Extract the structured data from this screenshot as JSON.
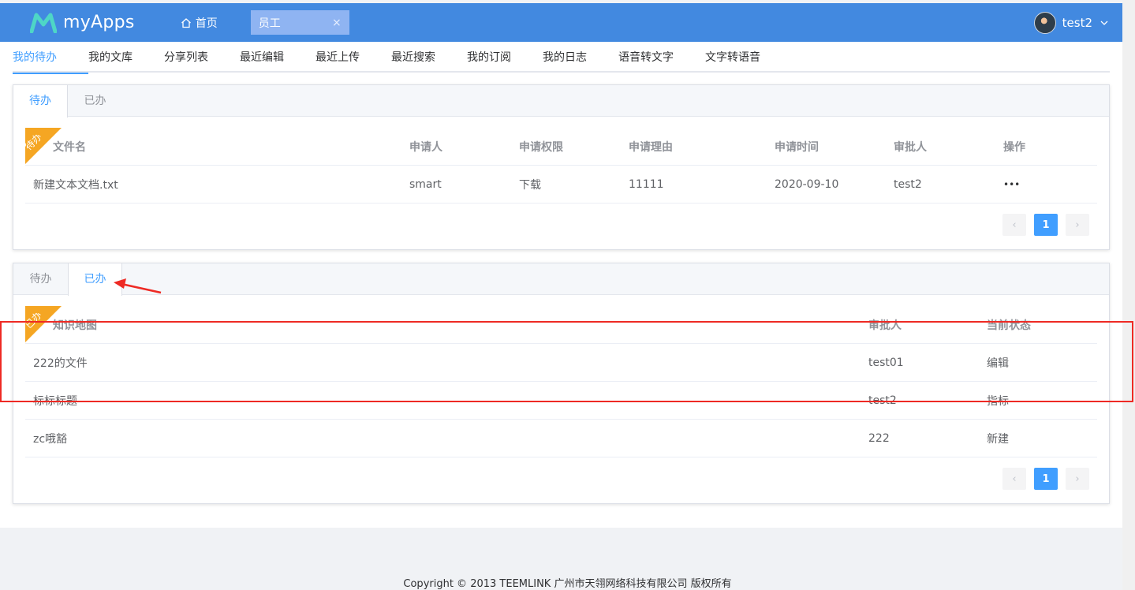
{
  "header": {
    "app_name": "myApps",
    "home_label": "首页",
    "open_tab": {
      "label": "员工",
      "close": "×"
    },
    "user_name": "test2"
  },
  "nav": {
    "items": [
      "我的待办",
      "我的文库",
      "分享列表",
      "最近编辑",
      "最近上传",
      "最近搜索",
      "我的订阅",
      "我的日志",
      "语音转文字",
      "文字转语音"
    ],
    "active_index": 0
  },
  "card1": {
    "tabs": [
      "待办",
      "已办"
    ],
    "active_tab": 0,
    "ribbon": "待办",
    "columns": [
      "文件名",
      "申请人",
      "申请权限",
      "申请理由",
      "申请时间",
      "审批人",
      "操作"
    ],
    "rows": [
      [
        "新建文本文档.txt",
        "smart",
        "下载",
        "11111",
        "2020-09-10",
        "test2",
        "•••"
      ]
    ],
    "pager": {
      "prev": "‹",
      "page": "1",
      "next": "›"
    }
  },
  "card2": {
    "tabs": [
      "待办",
      "已办"
    ],
    "active_tab": 1,
    "ribbon": "已办",
    "columns": [
      "知识地图",
      "审批人",
      "当前状态"
    ],
    "rows": [
      [
        "222的文件",
        "test01",
        "编辑"
      ],
      [
        "标标标题",
        "test2",
        "指标"
      ],
      [
        "zc哦豁",
        "222",
        "新建"
      ]
    ],
    "pager": {
      "prev": "‹",
      "page": "1",
      "next": "›"
    }
  },
  "footer": {
    "copyright": "Copyright © 2013 TEEMLINK 广州市天翎网络科技有限公司 版权所有"
  },
  "colors": {
    "header_bg": "#4289e0",
    "accent": "#409eff",
    "ribbon": "#f5a623",
    "annotation": "#ee2a24"
  }
}
